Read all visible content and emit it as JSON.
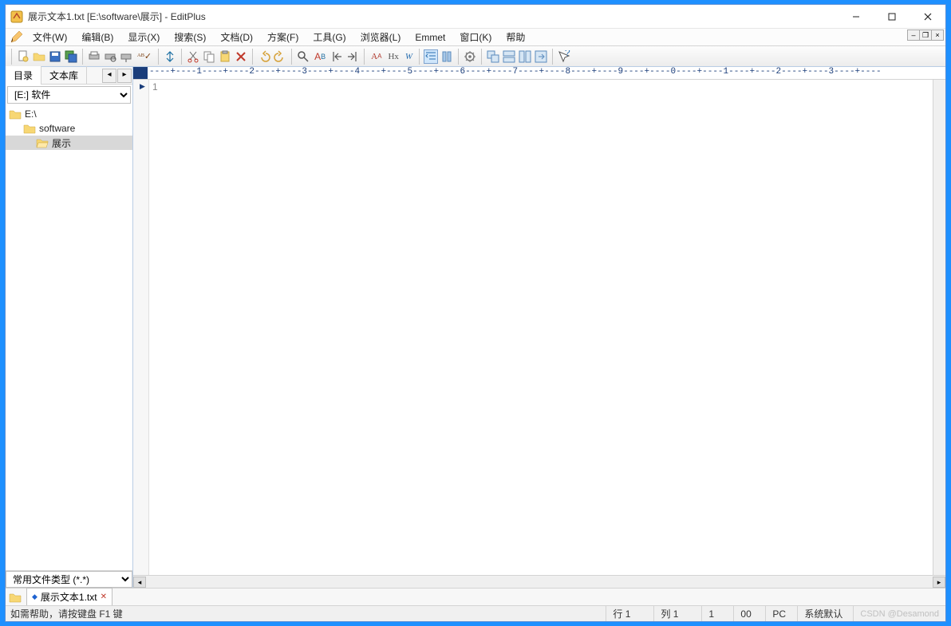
{
  "window": {
    "title": "展示文本1.txt [E:\\software\\展示] - EditPlus"
  },
  "menu": {
    "file": "文件(W)",
    "edit": "编辑(B)",
    "view": "显示(X)",
    "search": "搜索(S)",
    "document": "文档(D)",
    "project": "方案(F)",
    "tools": "工具(G)",
    "browser": "浏览器(L)",
    "emmet": "Emmet",
    "window": "窗口(K)",
    "help": "帮助"
  },
  "sidebar": {
    "tab_dir": "目录",
    "tab_lib": "文本库",
    "drive_selected": "[E:] 软件",
    "drive_options": [
      "[E:] 软件"
    ],
    "tree": [
      {
        "label": "E:\\",
        "level": 0,
        "selected": false
      },
      {
        "label": "software",
        "level": 1,
        "selected": false
      },
      {
        "label": "展示",
        "level": 2,
        "selected": true
      }
    ],
    "filetype_selected": "常用文件类型 (*.*)",
    "filetype_options": [
      "常用文件类型 (*.*)"
    ]
  },
  "editor": {
    "ruler": "----+----1----+----2----+----3----+----4----+----5----+----6----+----7----+----8----+----9----+----0----+----1----+----2----+----3----+----",
    "line1": "1",
    "content": ""
  },
  "doc_tab": {
    "name": "展示文本1.txt"
  },
  "status": {
    "help": "如需帮助，请按键盘 F1 键",
    "row": "行 1",
    "col": "列 1",
    "num1": "1",
    "num2": "00",
    "encoding": "PC",
    "syntax": "系统默认",
    "watermark": "CSDN @Desamond"
  }
}
